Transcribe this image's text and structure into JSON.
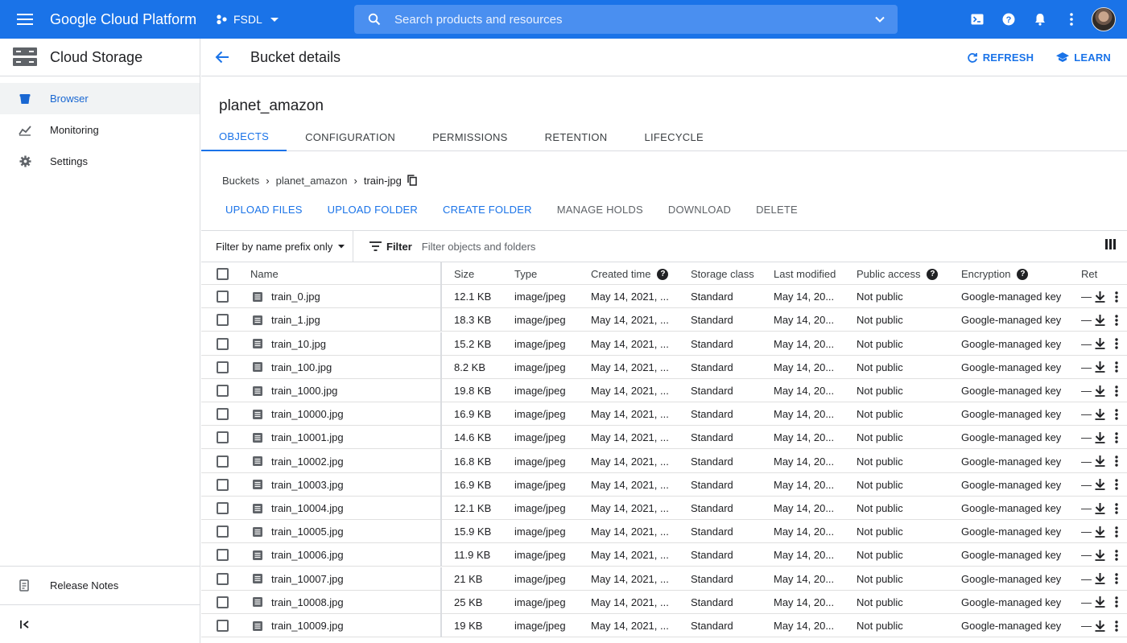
{
  "topbar": {
    "brand": "Google Cloud Platform",
    "project": "FSDL",
    "search_placeholder": "Search products and resources"
  },
  "sidebar": {
    "title": "Cloud Storage",
    "items": [
      {
        "label": "Browser",
        "active": true
      },
      {
        "label": "Monitoring"
      },
      {
        "label": "Settings"
      }
    ],
    "release_notes": "Release Notes"
  },
  "header": {
    "title": "Bucket details",
    "refresh": "REFRESH",
    "learn": "LEARN"
  },
  "bucket": {
    "name": "planet_amazon",
    "tabs": [
      "OBJECTS",
      "CONFIGURATION",
      "PERMISSIONS",
      "RETENTION",
      "LIFECYCLE"
    ]
  },
  "breadcrumb": [
    "Buckets",
    "planet_amazon",
    "train-jpg"
  ],
  "toolbar": {
    "upload_files": "UPLOAD FILES",
    "upload_folder": "UPLOAD FOLDER",
    "create_folder": "CREATE FOLDER",
    "manage_holds": "MANAGE HOLDS",
    "download": "DOWNLOAD",
    "delete": "DELETE"
  },
  "filter": {
    "mode": "Filter by name prefix only",
    "label": "Filter",
    "placeholder": "Filter objects and folders"
  },
  "table": {
    "columns": [
      "Name",
      "Size",
      "Type",
      "Created time",
      "Storage class",
      "Last modified",
      "Public access",
      "Encryption",
      "Ret"
    ],
    "rows": [
      {
        "name": "train_0.jpg",
        "size": "12.1 KB",
        "type": "image/jpeg",
        "created": "May 14, 2021, ...",
        "storage": "Standard",
        "modified": "May 14, 20...",
        "access": "Not public",
        "encryption": "Google-managed key",
        "ret": "—"
      },
      {
        "name": "train_1.jpg",
        "size": "18.3 KB",
        "type": "image/jpeg",
        "created": "May 14, 2021, ...",
        "storage": "Standard",
        "modified": "May 14, 20...",
        "access": "Not public",
        "encryption": "Google-managed key",
        "ret": "—"
      },
      {
        "name": "train_10.jpg",
        "size": "15.2 KB",
        "type": "image/jpeg",
        "created": "May 14, 2021, ...",
        "storage": "Standard",
        "modified": "May 14, 20...",
        "access": "Not public",
        "encryption": "Google-managed key",
        "ret": "—"
      },
      {
        "name": "train_100.jpg",
        "size": "8.2 KB",
        "type": "image/jpeg",
        "created": "May 14, 2021, ...",
        "storage": "Standard",
        "modified": "May 14, 20...",
        "access": "Not public",
        "encryption": "Google-managed key",
        "ret": "—"
      },
      {
        "name": "train_1000.jpg",
        "size": "19.8 KB",
        "type": "image/jpeg",
        "created": "May 14, 2021, ...",
        "storage": "Standard",
        "modified": "May 14, 20...",
        "access": "Not public",
        "encryption": "Google-managed key",
        "ret": "—"
      },
      {
        "name": "train_10000.jpg",
        "size": "16.9 KB",
        "type": "image/jpeg",
        "created": "May 14, 2021, ...",
        "storage": "Standard",
        "modified": "May 14, 20...",
        "access": "Not public",
        "encryption": "Google-managed key",
        "ret": "—"
      },
      {
        "name": "train_10001.jpg",
        "size": "14.6 KB",
        "type": "image/jpeg",
        "created": "May 14, 2021, ...",
        "storage": "Standard",
        "modified": "May 14, 20...",
        "access": "Not public",
        "encryption": "Google-managed key",
        "ret": "—"
      },
      {
        "name": "train_10002.jpg",
        "size": "16.8 KB",
        "type": "image/jpeg",
        "created": "May 14, 2021, ...",
        "storage": "Standard",
        "modified": "May 14, 20...",
        "access": "Not public",
        "encryption": "Google-managed key",
        "ret": "—"
      },
      {
        "name": "train_10003.jpg",
        "size": "16.9 KB",
        "type": "image/jpeg",
        "created": "May 14, 2021, ...",
        "storage": "Standard",
        "modified": "May 14, 20...",
        "access": "Not public",
        "encryption": "Google-managed key",
        "ret": "—"
      },
      {
        "name": "train_10004.jpg",
        "size": "12.1 KB",
        "type": "image/jpeg",
        "created": "May 14, 2021, ...",
        "storage": "Standard",
        "modified": "May 14, 20...",
        "access": "Not public",
        "encryption": "Google-managed key",
        "ret": "—"
      },
      {
        "name": "train_10005.jpg",
        "size": "15.9 KB",
        "type": "image/jpeg",
        "created": "May 14, 2021, ...",
        "storage": "Standard",
        "modified": "May 14, 20...",
        "access": "Not public",
        "encryption": "Google-managed key",
        "ret": "—"
      },
      {
        "name": "train_10006.jpg",
        "size": "11.9 KB",
        "type": "image/jpeg",
        "created": "May 14, 2021, ...",
        "storage": "Standard",
        "modified": "May 14, 20...",
        "access": "Not public",
        "encryption": "Google-managed key",
        "ret": "—"
      },
      {
        "name": "train_10007.jpg",
        "size": "21 KB",
        "type": "image/jpeg",
        "created": "May 14, 2021, ...",
        "storage": "Standard",
        "modified": "May 14, 20...",
        "access": "Not public",
        "encryption": "Google-managed key",
        "ret": "—"
      },
      {
        "name": "train_10008.jpg",
        "size": "25 KB",
        "type": "image/jpeg",
        "created": "May 14, 2021, ...",
        "storage": "Standard",
        "modified": "May 14, 20...",
        "access": "Not public",
        "encryption": "Google-managed key",
        "ret": "—"
      },
      {
        "name": "train_10009.jpg",
        "size": "19 KB",
        "type": "image/jpeg",
        "created": "May 14, 2021, ...",
        "storage": "Standard",
        "modified": "May 14, 20...",
        "access": "Not public",
        "encryption": "Google-managed key",
        "ret": "—"
      }
    ]
  },
  "colors": {
    "brand_blue": "#1a73e8",
    "border": "#dadce0",
    "active_bg": "#f1f3f4"
  }
}
